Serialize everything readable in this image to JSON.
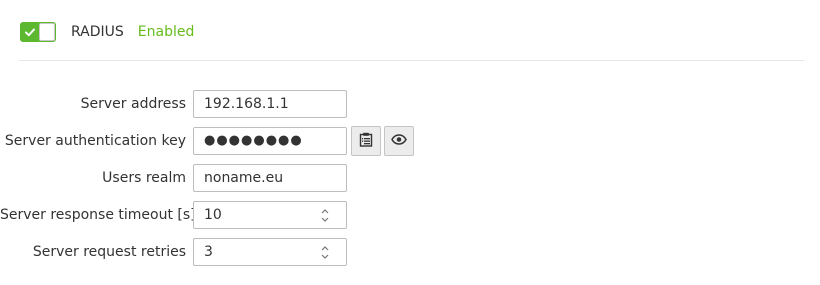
{
  "header": {
    "title": "RADIUS",
    "status": "Enabled",
    "toggle_on": true,
    "accent_color": "#5cb82f",
    "status_color": "#66bb1d"
  },
  "form": {
    "server_address": {
      "label": "Server address",
      "value": "192.168.1.1"
    },
    "auth_key": {
      "label": "Server authentication key",
      "value": "●●●●●●●●",
      "paste_icon": "clipboard-icon",
      "show_icon": "eye-icon"
    },
    "users_realm": {
      "label": "Users realm",
      "value": "noname.eu"
    },
    "timeout": {
      "label": "Server response timeout [s]",
      "value": "10"
    },
    "retries": {
      "label": "Server request retries",
      "value": "3"
    }
  }
}
